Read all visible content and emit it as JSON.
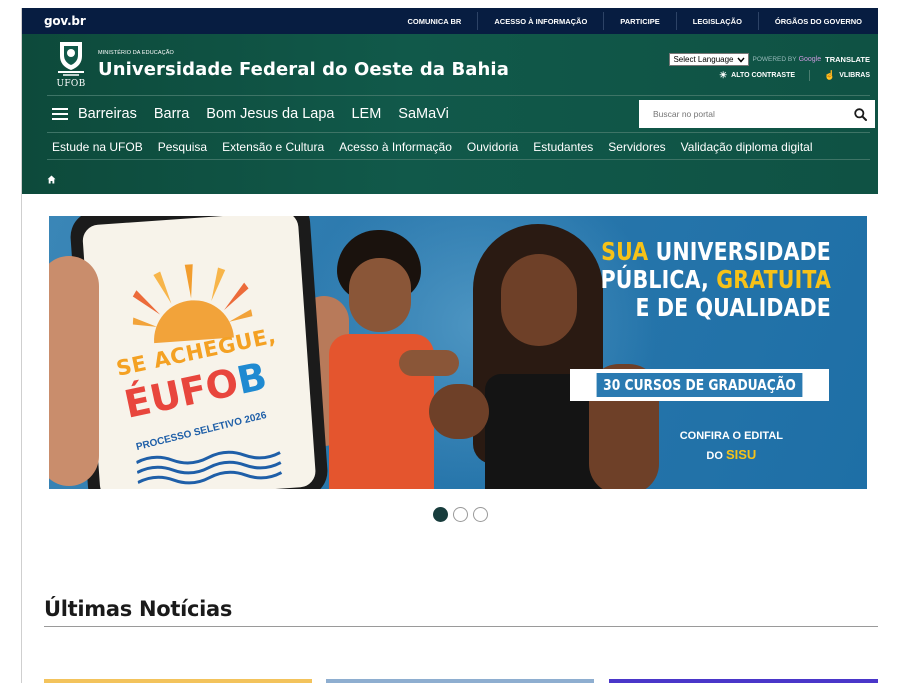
{
  "govbar": {
    "logo": "gov.br",
    "links": [
      "COMUNICA BR",
      "ACESSO À INFORMAÇÃO",
      "PARTICIPE",
      "LEGISLAÇÃO",
      "ÓRGÃOS DO GOVERNO"
    ]
  },
  "header": {
    "ministry": "MINISTÉRIO DA EDUCAÇÃO",
    "university": "Universidade Federal do Oeste da Bahia",
    "crest_label": "UFOB",
    "language_select": "Select Language",
    "powered_by": "POWERED BY",
    "google": "Google",
    "translate": "TRANSLATE",
    "high_contrast": "ALTO CONTRASTE",
    "vlibras": "VLIBRAS"
  },
  "hubs": [
    "Barreiras",
    "Barra",
    "Bom Jesus da Lapa",
    "LEM",
    "SaMaVi"
  ],
  "search": {
    "placeholder": "Buscar no portal"
  },
  "nav": [
    "Estude na UFOB",
    "Pesquisa",
    "Extensão e Cultura",
    "Acesso à Informação",
    "Ouvidoria",
    "Estudantes",
    "Servidores",
    "Validação diploma digital"
  ],
  "banner": {
    "phone_line1": "SE ACHEGUE,",
    "phone_e": "É",
    "phone_ufo": "UFO",
    "phone_b": "B",
    "phone_line3": "PROCESSO SELETIVO 2026",
    "headline_sua": "SUA",
    "headline_universidade": "UNIVERSIDADE",
    "headline_publica": "PÚBLICA,",
    "headline_gratuita": "GRATUITA",
    "headline_line3": "E DE QUALIDADE",
    "courses": "30 CURSOS DE GRADUAÇÃO",
    "confira": "CONFIRA O EDITAL",
    "do": "DO",
    "sisu": "SISU",
    "slides": 3,
    "active_slide": 1
  },
  "news": {
    "title": "Últimas Notícias"
  },
  "colors": {
    "govbar": "#071d41",
    "header_green": "#11594a",
    "banner_blue": "#2a78ad",
    "accent_yellow": "#f7c218"
  }
}
